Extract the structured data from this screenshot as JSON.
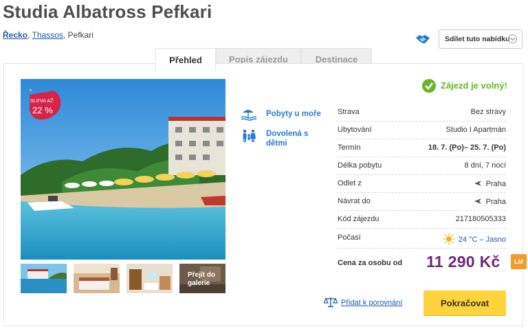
{
  "header": {
    "title": "Studia Albatross Pefkari",
    "breadcrumb": [
      {
        "label": "Řecko"
      },
      {
        "label": "Thassos"
      },
      {
        "label": "Pefkari"
      }
    ],
    "share_label": "Sdílet tuto nabídku"
  },
  "tabs": [
    {
      "label": "Přehled",
      "active": true
    },
    {
      "label": "Popis zájezdu",
      "active": false
    },
    {
      "label": "Destinace",
      "active": false
    }
  ],
  "gallery": {
    "sale_line1": "SLEVA AŽ",
    "sale_line2": "22 %",
    "gallery_link": "Přejít do galerie"
  },
  "features": [
    {
      "label": "Pobyty u moře",
      "icon": "beach-umbrella-icon"
    },
    {
      "label": "Dovolená s dětmi",
      "icon": "family-icon"
    }
  ],
  "availability": "Zájezd je volný!",
  "details": [
    {
      "label": "Strava",
      "value": "Bez stravy"
    },
    {
      "label": "Ubytování",
      "value": "Studio I Apartmán"
    },
    {
      "label": "Termín",
      "value": "18. 7. (Po)– 25. 7. (Po)"
    },
    {
      "label": "Délka pobytu",
      "value": "8 dní, 7 nocí"
    },
    {
      "label": "Odlet z",
      "value": "Praha"
    },
    {
      "label": "Návrat do",
      "value": "Praha"
    },
    {
      "label": "Kód zájezdu",
      "value": "217180505333"
    },
    {
      "label": "Počasí",
      "value": "24 °C – Jasno"
    }
  ],
  "price": {
    "label": "Cena za osobu od",
    "value": "11 290 Kč",
    "badge": "LM"
  },
  "actions": {
    "compare": "Přidat k porovnání",
    "continue": "Pokračovat"
  },
  "colors": {
    "accent_blue": "#1f5aa6",
    "available_green": "#6ab42d",
    "price_purple": "#6b2b7a",
    "cta_yellow": "#ffd33c",
    "lm_orange": "#f39a2a"
  }
}
